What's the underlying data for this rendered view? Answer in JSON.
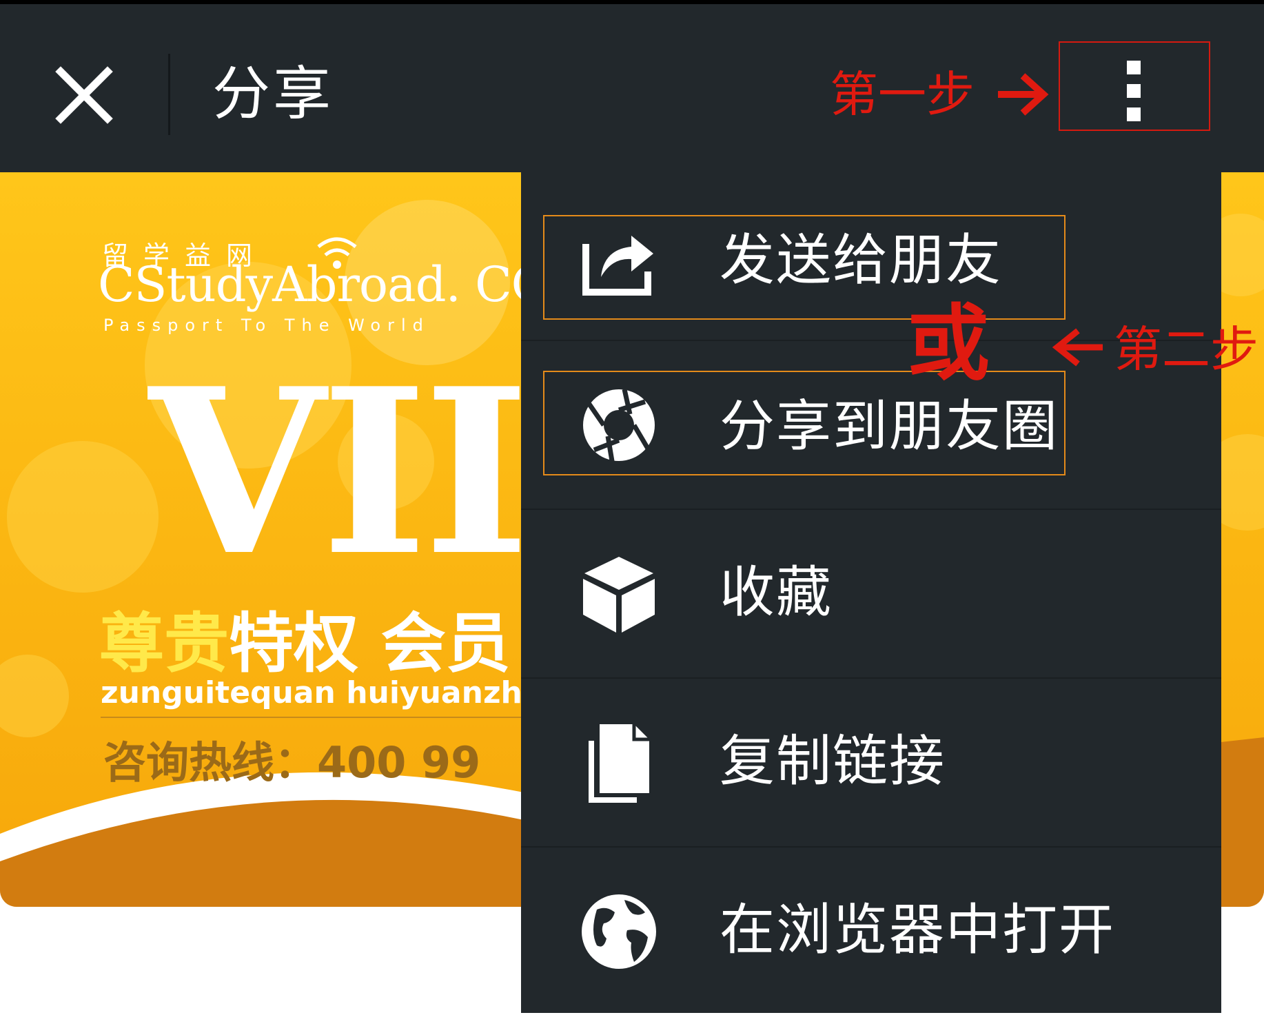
{
  "header": {
    "title": "分享",
    "close_icon": "close-icon",
    "more_icon": "more-vertical-icon"
  },
  "annotations": {
    "step1": "第一步",
    "step2": "第二步",
    "or": "或",
    "color": "#e01a10"
  },
  "page": {
    "brand_cn": "留学益网",
    "brand_en": "CStudyAbroad.",
    "brand_com": "COM",
    "brand_tagline": "Passport To The World",
    "vip": "VII",
    "slogan_highlight": "尊贵",
    "slogan_rest": "特权 会员",
    "pinyin": "zunguitequan huiyuanzh",
    "hotline": "咨询热线：400 99",
    "colors": {
      "card": "#fbb40f",
      "highlight": "#ffe94a",
      "hotline": "#9b6a18"
    }
  },
  "menu": {
    "items": [
      {
        "label": "发送给朋友",
        "icon": "share-forward-icon",
        "highlighted": true
      },
      {
        "label": "分享到朋友圈",
        "icon": "aperture-moments-icon",
        "highlighted": true
      },
      {
        "label": "收藏",
        "icon": "cube-favorite-icon",
        "highlighted": false
      },
      {
        "label": "复制链接",
        "icon": "copy-document-icon",
        "highlighted": false
      },
      {
        "label": "在浏览器中打开",
        "icon": "globe-icon",
        "highlighted": false
      }
    ],
    "highlight_color": "#e58b1a",
    "background": "#22282c"
  }
}
